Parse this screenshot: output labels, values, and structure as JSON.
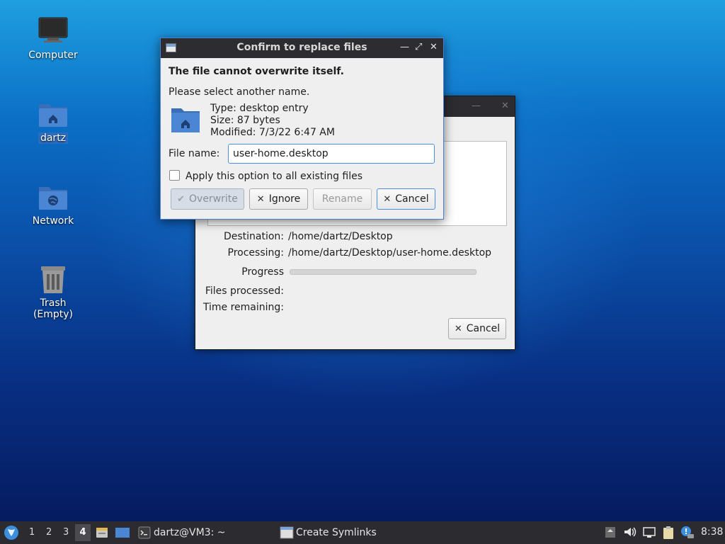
{
  "desktop": {
    "icons": [
      {
        "label": "Computer"
      },
      {
        "label": "dartz"
      },
      {
        "label": "Network"
      },
      {
        "label": "Trash (Empty)"
      }
    ]
  },
  "progress_dialog": {
    "destination_label": "Destination:",
    "destination_value": "/home/dartz/Desktop",
    "processing_label": "Processing:",
    "processing_value": "/home/dartz/Desktop/user-home.desktop",
    "progress_label": "Progress",
    "progress_value": 0,
    "files_processed_label": "Files processed:",
    "time_remaining_label": "Time remaining:",
    "cancel_label": "Cancel"
  },
  "confirm_dialog": {
    "title": "Confirm to replace files",
    "heading": "The file cannot overwrite itself.",
    "instruction": "Please select another name.",
    "file_type": "Type: desktop entry",
    "file_size": "Size: 87 bytes",
    "file_modified": "Modified: 7/3/22 6:47 AM",
    "file_name_label": "File name:",
    "file_name_value": "user-home.desktop",
    "apply_all_label": "Apply this option to all existing files",
    "apply_all_checked": false,
    "buttons": {
      "overwrite": "Overwrite",
      "ignore": "Ignore",
      "rename": "Rename",
      "cancel": "Cancel"
    }
  },
  "taskbar": {
    "workspaces": [
      "1",
      "2",
      "3",
      "4"
    ],
    "active_workspace": "4",
    "tasks": [
      {
        "label": "dartz@VM3: ~"
      },
      {
        "label": "Create Symlinks"
      }
    ],
    "clock": "8:38"
  },
  "colors": {
    "titlebar": "#2c2c31",
    "accent": "#4a90e2",
    "taskbar": "#2b2b30",
    "folder": "#4a86d4"
  }
}
